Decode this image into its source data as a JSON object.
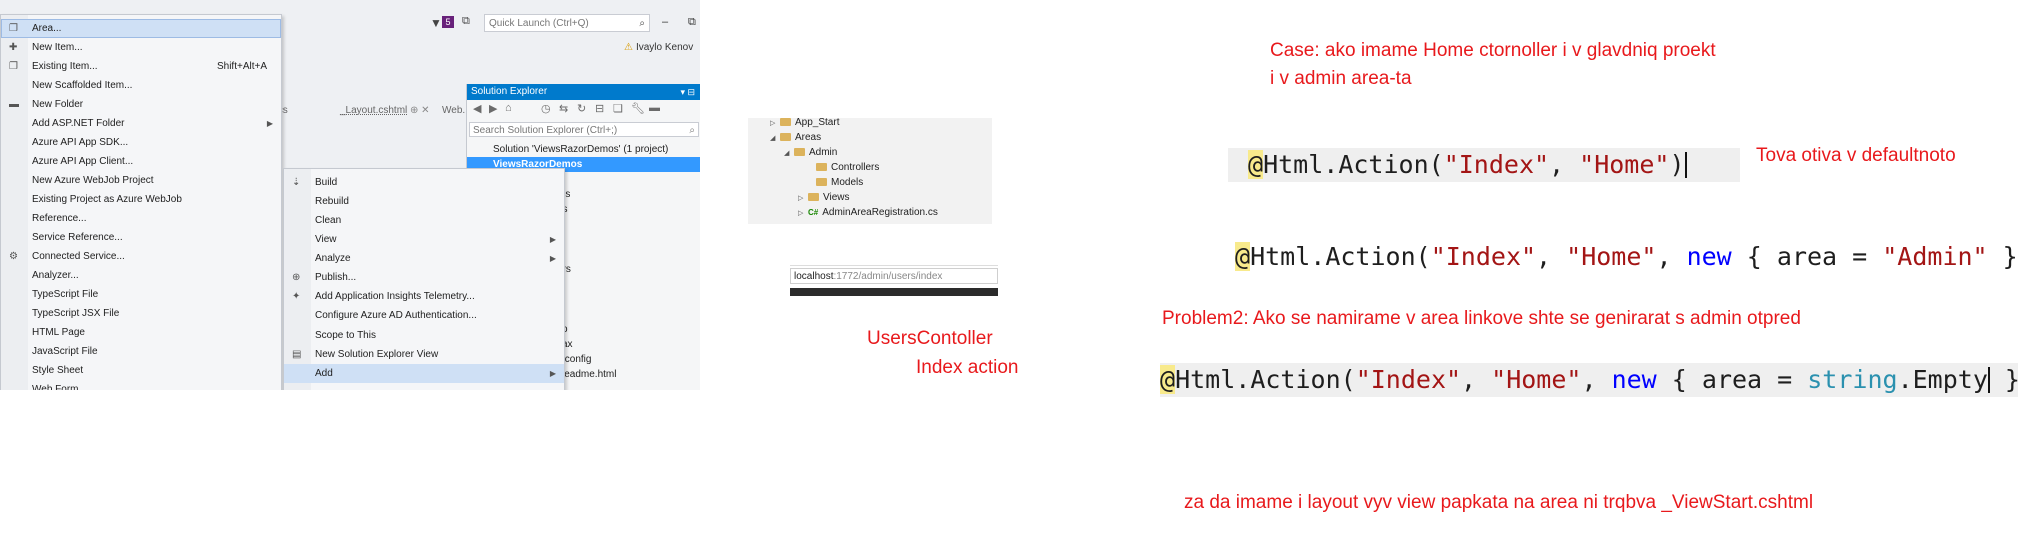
{
  "vs": {
    "quick_launch": "Quick Launch (Ctrl+Q)",
    "badge": "5",
    "user": "Ivaylo Kenov",
    "tabs": [
      "s.cs",
      "_Layout.cshtml",
      "Web."
    ],
    "menu1": [
      {
        "label": "Area...",
        "shortcut": "",
        "highlight": true
      },
      {
        "label": "New Item...",
        "shortcut": ""
      },
      {
        "label": "Existing Item...",
        "shortcut": "Shift+Alt+A"
      },
      {
        "label": "New Scaffolded Item...",
        "shortcut": ""
      },
      {
        "label": "New Folder",
        "shortcut": ""
      },
      {
        "label": "Add ASP.NET Folder",
        "shortcut": ""
      },
      {
        "label": "Azure API App SDK...",
        "shortcut": ""
      },
      {
        "label": "Azure API App Client...",
        "shortcut": ""
      },
      {
        "label": "New Azure WebJob Project",
        "shortcut": ""
      },
      {
        "label": "Existing Project as Azure WebJob",
        "shortcut": ""
      },
      {
        "label": "Reference...",
        "shortcut": ""
      },
      {
        "label": "Service Reference...",
        "shortcut": ""
      },
      {
        "label": "Connected Service...",
        "shortcut": ""
      },
      {
        "label": "Analyzer...",
        "shortcut": ""
      },
      {
        "label": "TypeScript File",
        "shortcut": ""
      },
      {
        "label": "TypeScript JSX File",
        "shortcut": ""
      },
      {
        "label": "HTML Page",
        "shortcut": ""
      },
      {
        "label": "JavaScript File",
        "shortcut": ""
      },
      {
        "label": "Style Sheet",
        "shortcut": ""
      },
      {
        "label": "Web Form",
        "shortcut": ""
      }
    ],
    "menu2": [
      {
        "label": "Build"
      },
      {
        "label": "Rebuild"
      },
      {
        "label": "Clean"
      },
      {
        "label": "View"
      },
      {
        "label": "Analyze"
      },
      {
        "label": "Publish..."
      },
      {
        "label": "Add Application Insights Telemetry..."
      },
      {
        "label": "Configure Azure AD Authentication..."
      },
      {
        "label": "Scope to This"
      },
      {
        "label": "New Solution Explorer View"
      },
      {
        "label": "Add",
        "highlight": true
      }
    ],
    "solution_explorer": {
      "title": "Solution Explorer",
      "search_placeholder": "Search Solution Explorer (Ctrl+;)",
      "rows": [
        "Solution 'ViewsRazorDemos' (1 project)",
        "ViewsRazorDemos",
        "s",
        "tes",
        "es",
        "a",
        "rt",
        "",
        "ers",
        "",
        "",
        "",
        "co",
        "sax",
        "s.config",
        "Readme.html"
      ]
    }
  },
  "tree": {
    "rows": [
      "App_Start",
      "Areas",
      "Admin",
      "Controllers",
      "Models",
      "Views",
      "AdminAreaRegistration.cs"
    ]
  },
  "url": {
    "host": "localhost",
    "path": ":1772/admin/users/index"
  },
  "notes": {
    "case_line1": "Case: ako imame Home ctornoller i v glavdniq proekt",
    "case_line2": "i v admin area-ta",
    "tova": "Tova otiva v defaultnoto",
    "users_controller": "UsersContoller",
    "index_action": "Index action",
    "problem2": "Problem2: Ako se namirame v area linkove shte se genirarat s admin otpred",
    "layout": "za da imame i layout vyv view papkata na area ni trqbva _ViewStart.cshtml"
  },
  "code": {
    "line1": {
      "at": "@",
      "method": "Html.Action(",
      "s1": "\"Index\"",
      "sep": ", ",
      "s2": "\"Home\"",
      "close": ")"
    },
    "line2": {
      "at": "@",
      "method": "Html.Action(",
      "s1": "\"Index\"",
      "sep": ", ",
      "s2": "\"Home\"",
      "sep2": ", ",
      "kw": "new",
      "mid": " { area = ",
      "s3": "\"Admin\"",
      "close": " })"
    },
    "line3": {
      "at": "@",
      "method": "Html.Action(",
      "s1": "\"Index\"",
      "sep": ", ",
      "s2": "\"Home\"",
      "sep2": ", ",
      "kw": "new",
      "mid": " { area = ",
      "typ": "string",
      "dot": ".Empty",
      "close": " })"
    }
  },
  "colors": {
    "annotation": "#e8191c",
    "vs_blue": "#007acc",
    "selection": "#3399ff"
  }
}
